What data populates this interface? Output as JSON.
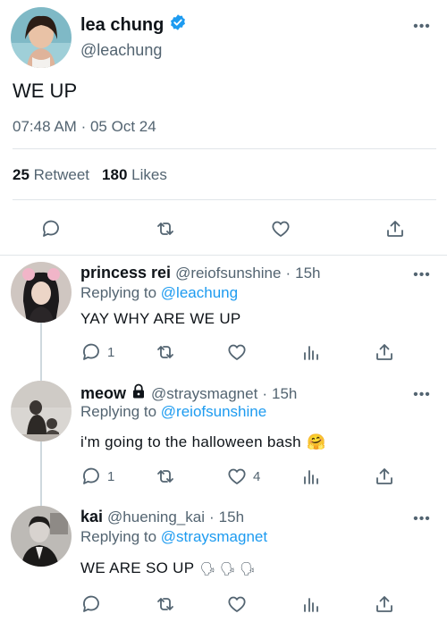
{
  "main_tweet": {
    "author_name": "lea chung",
    "author_handle": "@leachung",
    "verified_icon": "verified-badge-icon",
    "text": "WE UP",
    "time": "07:48 AM",
    "separator": "·",
    "date": "05 Oct 24",
    "retweet_count": "25",
    "retweet_label": "Retweet",
    "likes_count": "180",
    "likes_label": "Likes",
    "more_glyph": "•••",
    "actions": [
      "reply-icon",
      "retweet-icon",
      "like-icon",
      "share-icon"
    ]
  },
  "replies": [
    {
      "name": "princess rei",
      "handle": "@reiofsunshine",
      "dot": "·",
      "time": "15h",
      "replying_prefix": "Replying to",
      "replying_to": "@leachung",
      "text": "YAY WHY ARE WE UP",
      "reply_count": "1",
      "retweet_count": "",
      "like_count": "",
      "more_glyph": "•••"
    },
    {
      "name": "meow",
      "handle": "@straysmagnet",
      "dot": "·",
      "time": "15h",
      "replying_prefix": "Replying to",
      "replying_to": "@reiofsunshine",
      "text": "i'm going to the halloween bash",
      "emoji": "🤗",
      "reply_count": "1",
      "retweet_count": "",
      "like_count": "4",
      "more_glyph": "•••"
    },
    {
      "name": "kai",
      "handle": "@huening_kai",
      "dot": "·",
      "time": "15h",
      "replying_prefix": "Replying to",
      "replying_to": "@straysmagnet",
      "text": "WE ARE SO UP",
      "emoji": "🗣 🗣 🗣",
      "reply_count": "",
      "retweet_count": "",
      "like_count": "",
      "more_glyph": "•••"
    }
  ],
  "colors": {
    "accent": "#1d9bf0",
    "secondary_text": "#536471",
    "primary_text": "#0f1419",
    "divider": "#e1e5e9"
  }
}
